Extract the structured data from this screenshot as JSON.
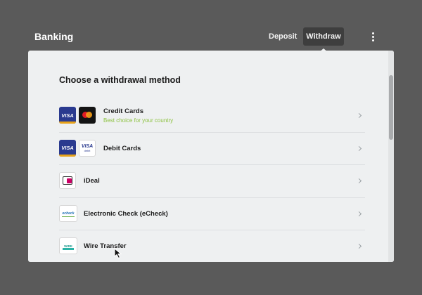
{
  "header": {
    "title": "Banking",
    "tabs": [
      {
        "label": "Deposit",
        "active": false
      },
      {
        "label": "Withdraw",
        "active": true
      }
    ],
    "menu_icon": "kebab-menu-icon"
  },
  "panel": {
    "heading": "Choose a withdrawal method",
    "methods": [
      {
        "name": "Credit Cards",
        "subtitle": "Best choice for your country",
        "logos": [
          "visa-logo",
          "mastercard-logo"
        ]
      },
      {
        "name": "Debit Cards",
        "subtitle": "",
        "logos": [
          "visa-logo",
          "visa-debit-logo"
        ]
      },
      {
        "name": "iDeal",
        "subtitle": "",
        "logos": [
          "ideal-logo"
        ]
      },
      {
        "name": "Electronic Check (eCheck)",
        "subtitle": "",
        "logos": [
          "echeck-logo"
        ]
      },
      {
        "name": "Wire Transfer",
        "subtitle": "",
        "logos": [
          "wire-transfer-logo"
        ]
      }
    ]
  },
  "colors": {
    "background": "#5a5a5a",
    "panel": "#eef0f1",
    "active_tab": "#3e3e3e",
    "highlight_text": "#8dc241"
  }
}
